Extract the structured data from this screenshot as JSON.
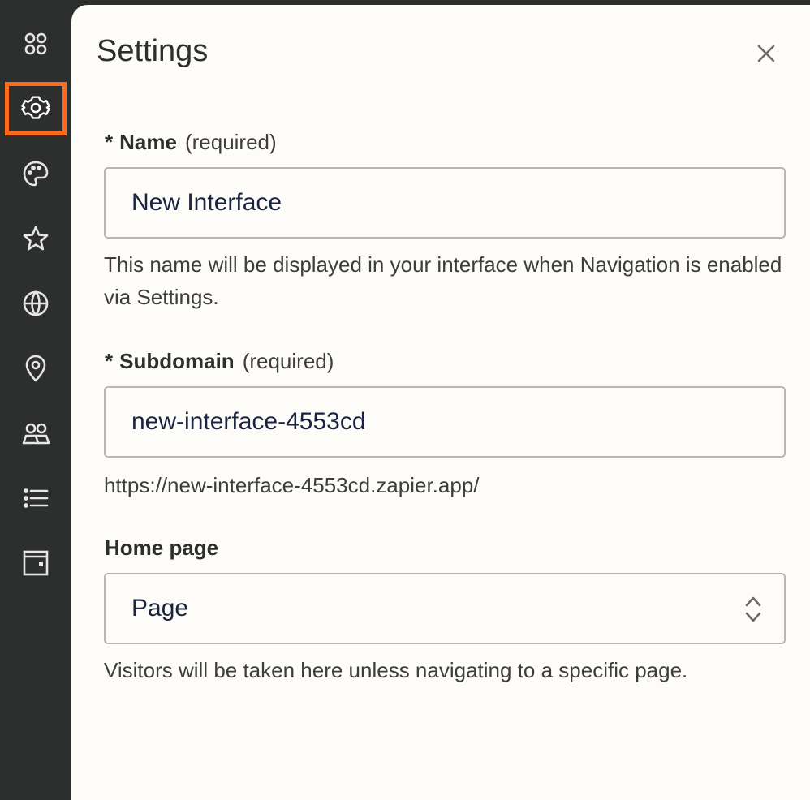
{
  "sidebar": {
    "items": [
      {
        "name": "apps",
        "icon": "apps-icon",
        "active": false
      },
      {
        "name": "settings",
        "icon": "gear-icon",
        "active": true
      },
      {
        "name": "theme",
        "icon": "palette-icon",
        "active": false
      },
      {
        "name": "favorites",
        "icon": "star-icon",
        "active": false
      },
      {
        "name": "domain",
        "icon": "globe-icon",
        "active": false
      },
      {
        "name": "location",
        "icon": "location-pin-icon",
        "active": false
      },
      {
        "name": "users",
        "icon": "users-icon",
        "active": false
      },
      {
        "name": "list",
        "icon": "list-icon",
        "active": false
      },
      {
        "name": "layout",
        "icon": "layout-icon",
        "active": false
      }
    ],
    "active_border_color": "#ff6a1a"
  },
  "settings": {
    "title": "Settings",
    "close_icon": "close-icon",
    "name_field": {
      "asterisk": "*",
      "label": "Name",
      "required_text": "(required)",
      "value": "New Interface",
      "help": "This name will be displayed in your interface when Navigation is enabled via Settings."
    },
    "subdomain_field": {
      "asterisk": "*",
      "label": "Subdomain",
      "required_text": "(required)",
      "value": "new-interface-4553cd",
      "url": "https://new-interface-4553cd.zapier.app/"
    },
    "home_page_field": {
      "label": "Home page",
      "selected": "Page",
      "help": "Visitors will be taken here unless navigating to a specific page."
    }
  }
}
